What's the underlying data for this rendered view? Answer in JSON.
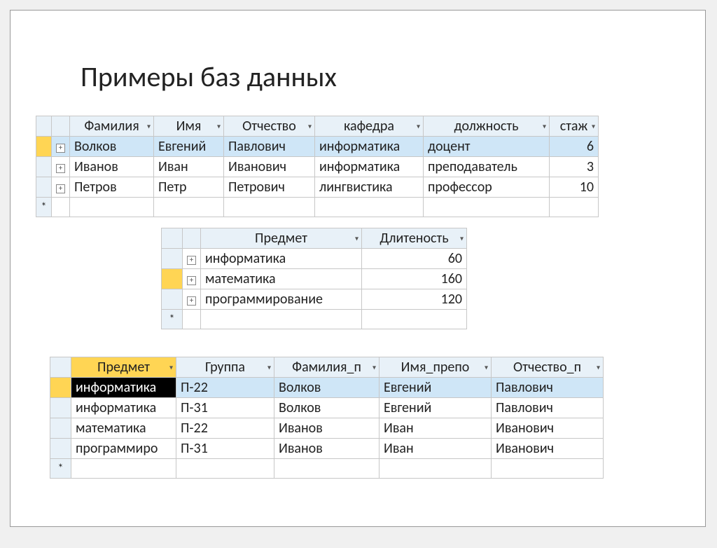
{
  "title": "Примеры баз данных",
  "star": "*",
  "plus": "+",
  "table1": {
    "headers": [
      "Фамилия",
      "Имя",
      "Отчество",
      "кафедра",
      "должность",
      "стаж"
    ],
    "rows": [
      {
        "c0": "Волков",
        "c1": "Евгений",
        "c2": "Павлович",
        "c3": "информатика",
        "c4": "доцент",
        "c5": "6"
      },
      {
        "c0": "Иванов",
        "c1": "Иван",
        "c2": "Иванович",
        "c3": "информатика",
        "c4": "преподаватель",
        "c5": "3"
      },
      {
        "c0": "Петров",
        "c1": "Петр",
        "c2": "Петрович",
        "c3": "лингвистика",
        "c4": "профессор",
        "c5": "10"
      }
    ]
  },
  "table2": {
    "headers": [
      "Предмет",
      "Длитеность"
    ],
    "rows": [
      {
        "c0": "информатика",
        "c1": "60"
      },
      {
        "c0": "математика",
        "c1": "160"
      },
      {
        "c0": "программирование",
        "c1": "120"
      }
    ]
  },
  "table3": {
    "headers": [
      "Предмет",
      "Группа",
      "Фамилия_п",
      "Имя_препо",
      "Отчество_п"
    ],
    "rows": [
      {
        "c0": "информатика",
        "c1": "П-22",
        "c2": "Волков",
        "c3": "Евгений",
        "c4": "Павлович"
      },
      {
        "c0": "информатика",
        "c1": "П-31",
        "c2": "Волков",
        "c3": "Евгений",
        "c4": "Павлович"
      },
      {
        "c0": "математика",
        "c1": "П-22",
        "c2": "Иванов",
        "c3": "Иван",
        "c4": "Иванович"
      },
      {
        "c0": "программиро",
        "c1": "П-31",
        "c2": "Иванов",
        "c3": "Иван",
        "c4": "Иванович"
      }
    ]
  }
}
